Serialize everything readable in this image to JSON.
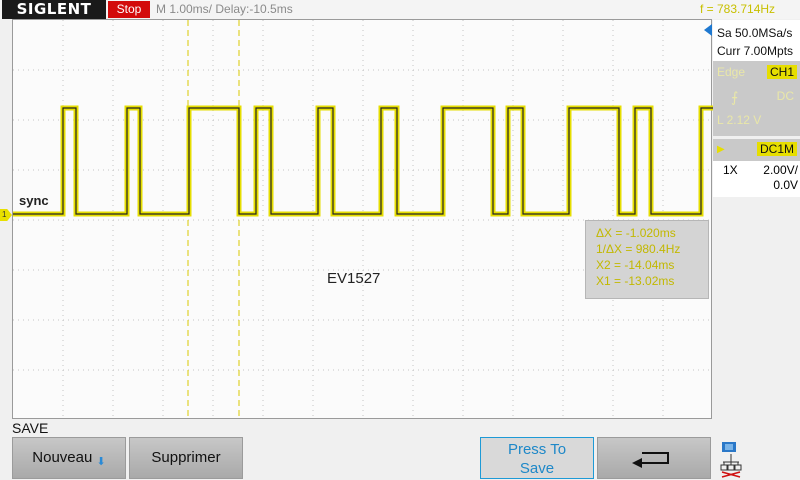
{
  "header": {
    "brand": "SIGLENT",
    "run_state": "Stop",
    "timebase": "M 1.00ms/ Delay:-10.5ms",
    "frequency": "f = 783.714Hz"
  },
  "acquisition": {
    "sample_rate": "Sa 50.0MSa/s",
    "memory": "Curr 7.00Mpts"
  },
  "trigger": {
    "type": "Edge",
    "source": "CH1",
    "coupling": "DC",
    "level": "L  2.12 V"
  },
  "channel": {
    "coupling": "DC1M",
    "probe": "1X",
    "scale": "2.00V/",
    "offset": "0.0V"
  },
  "screen": {
    "trace_label": "sync",
    "annotation": "EV1527",
    "channel_marker": "1"
  },
  "cursors": {
    "delta_x": "ΔX = -1.020ms",
    "inv_delta_x": "1/ΔX = 980.4Hz",
    "x2": "X2 = -14.04ms",
    "x1": "X1 = -13.02ms"
  },
  "menu": {
    "title": "SAVE",
    "buttons": {
      "new": "Nouveau",
      "delete": "Supprimer",
      "press_line1": "Press To",
      "press_line2": "Save"
    }
  },
  "colors": {
    "trace": "#e6de00",
    "accent_blue": "#1e88c8",
    "stop_red": "#d30b0b"
  },
  "chart_data": {
    "type": "line",
    "series": [
      {
        "name": "CH1",
        "edges_high": [
          [
            50,
            63
          ],
          [
            114,
            127
          ],
          [
            176,
            226
          ],
          [
            243,
            258
          ],
          [
            305,
            320
          ],
          [
            368,
            384
          ],
          [
            430,
            480
          ],
          [
            495,
            510
          ],
          [
            556,
            606
          ],
          [
            622,
            638
          ],
          [
            688,
            700
          ]
        ]
      }
    ]
  }
}
